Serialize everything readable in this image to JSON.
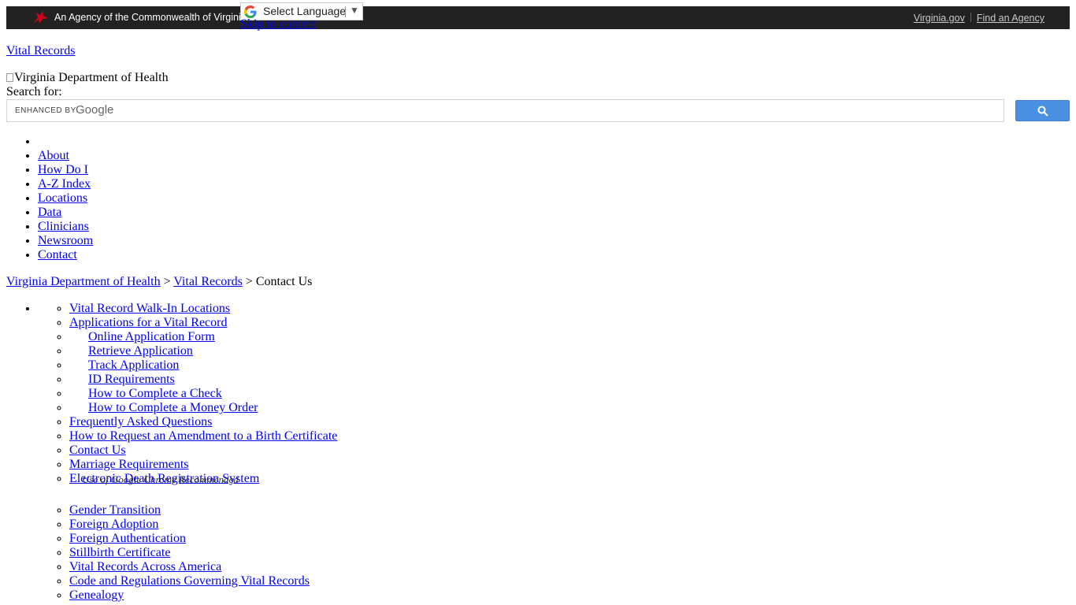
{
  "topbar": {
    "agency_text": "An Agency of the Commonwealth of Virginia",
    "links": [
      "Virginia.gov",
      "Find an Agency"
    ]
  },
  "translate": {
    "label": "Select Language",
    "arrow": "▼"
  },
  "skip_link": "Skip to content",
  "site_title": "Vital Records",
  "logo_alt": "Virginia Department of Health",
  "search": {
    "label": "Search for:",
    "enhanced_by": "ENHANCED BY",
    "brand": "Google",
    "value": ""
  },
  "nav": [
    "About",
    "How Do I",
    "A-Z Index",
    "Locations",
    "Data",
    "Clinicians",
    "Newsroom",
    "Contact"
  ],
  "breadcrumb": {
    "items": [
      "Virginia Department of Health",
      "Vital Records"
    ],
    "separator": ">",
    "current": "Contact Us"
  },
  "sidebar": {
    "items": [
      "Vital Record Walk-In Locations",
      "Applications for a Vital Record",
      "Online Application Form",
      "Retrieve Application",
      "Track Application",
      "ID Requirements",
      "How to Complete a Check",
      "How to Complete a Money Order",
      "Frequently Asked Questions",
      "How to Request an Amendment to a Birth Certificate",
      "Contact Us",
      "Marriage Requirements",
      "Electronic Death Registration System",
      "Gender Transition",
      "Foreign Adoption",
      "Foreign Authentication",
      "Stillbirth Certificate",
      "Vital Records Across America",
      "Code and Regulations Governing Vital Records",
      "Genealogy"
    ],
    "edrs_note": "Use of Google Chrome Recommended"
  },
  "colors": {
    "topbar_bg": "#222222",
    "link": "#0000ee",
    "search_button": "#4a90e2"
  }
}
